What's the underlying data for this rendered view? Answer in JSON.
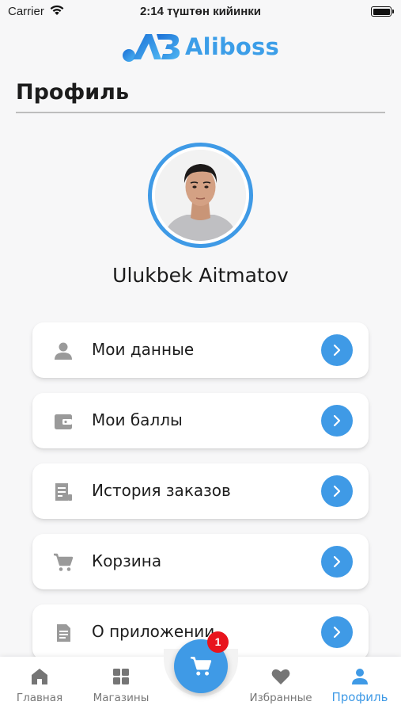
{
  "status_bar": {
    "carrier": "Carrier",
    "time": "2:14 түштөн кийинки"
  },
  "brand": {
    "name": "Aliboss",
    "accent_color": "#3f9ae6"
  },
  "page": {
    "title": "Профиль"
  },
  "profile": {
    "name": "Ulukbek Aitmatov"
  },
  "menu": {
    "items": [
      {
        "label": "Мои данные",
        "icon": "person-icon"
      },
      {
        "label": "Мои баллы",
        "icon": "wallet-icon"
      },
      {
        "label": "История заказов",
        "icon": "receipt-icon"
      },
      {
        "label": "Корзина",
        "icon": "cart-icon"
      },
      {
        "label": "О приложении",
        "icon": "document-icon"
      }
    ]
  },
  "bottom_nav": {
    "items": [
      {
        "label": "Главная",
        "icon": "home-icon"
      },
      {
        "label": "Магазины",
        "icon": "grid-icon"
      },
      {
        "label": "Избранные",
        "icon": "heart-icon"
      },
      {
        "label": "Профиль",
        "icon": "profile-icon",
        "active": true
      }
    ],
    "cart_badge": "1"
  }
}
